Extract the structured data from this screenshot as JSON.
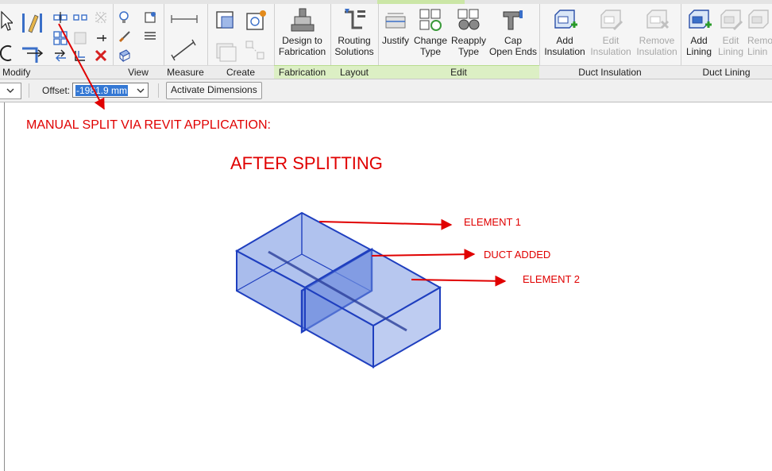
{
  "panels": {
    "modify": "Modify",
    "view": "View",
    "measure": "Measure",
    "create": "Create",
    "fabrication": "Fabrication",
    "layout": "Layout",
    "edit": "Edit",
    "duct_insulation": "Duct Insulation",
    "duct_lining": "Duct Lining"
  },
  "buttons": {
    "design_to_fabrication": [
      "Design to",
      "Fabrication"
    ],
    "routing_solutions": [
      "Routing",
      "Solutions"
    ],
    "justify": [
      "Justify",
      ""
    ],
    "change_type": [
      "Change",
      "Type"
    ],
    "reapply_type": [
      "Reapply",
      "Type"
    ],
    "cap_open_ends": [
      "Cap",
      "Open Ends"
    ],
    "add_insulation": [
      "Add",
      "Insulation"
    ],
    "edit_insulation": [
      "Edit",
      "Insulation"
    ],
    "remove_insulation": [
      "Remove",
      "Insulation"
    ],
    "add_lining": [
      "Add",
      "Lining"
    ],
    "edit_lining": [
      "Edit",
      "Lining"
    ],
    "remove_lining": [
      "Remo",
      "Linin"
    ]
  },
  "options_bar": {
    "offset_label": "Offset:",
    "offset_value": "-1981.9 mm",
    "activate_dimensions": "Activate Dimensions"
  },
  "annotations": {
    "heading": "MANUAL SPLIT VIA REVIT APPLICATION:",
    "subheading": "AFTER SPLITTING",
    "element1": "ELEMENT 1",
    "duct_added": "DUCT ADDED",
    "element2": "ELEMENT 2"
  },
  "colors": {
    "annotation": "#e00000",
    "duct_face": "#6f8fe0",
    "duct_edge": "#1f3fbf",
    "context_tab": "#cbe6a6",
    "selection": "#3478d4"
  }
}
